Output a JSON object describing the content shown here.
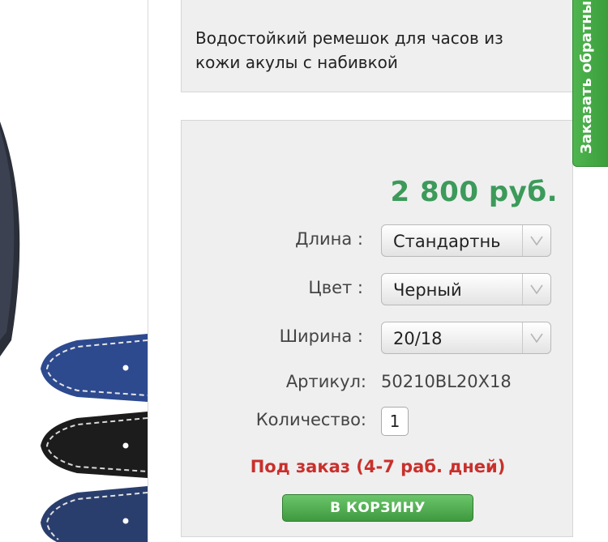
{
  "product": {
    "description": "Водостойкий ремешок для часов из кожи акулы с набивкой",
    "price": "2 800 руб."
  },
  "options": [
    {
      "label": "Длина :",
      "value": "Стандартнь"
    },
    {
      "label": "Цвет :",
      "value": "Черный"
    },
    {
      "label": "Ширина :",
      "value": "20/18"
    }
  ],
  "sku": {
    "label": "Артикул:",
    "value": "50210BL20X18"
  },
  "quantity": {
    "label": "Количество:",
    "value": "1"
  },
  "stock_status": "Под заказ (4-7 раб. дней)",
  "cart_button_label": "В КОРЗИНУ",
  "callback_tab_label": "Заказать обратный звонок",
  "colors": {
    "price": "#3c9a5a",
    "stock_status": "#c9302c",
    "button": "#4aa84a",
    "strap_blue": "#2d4a8f",
    "strap_black": "#1c1c1c"
  },
  "icons": {
    "select_arrow": "chevron-down-icon"
  }
}
